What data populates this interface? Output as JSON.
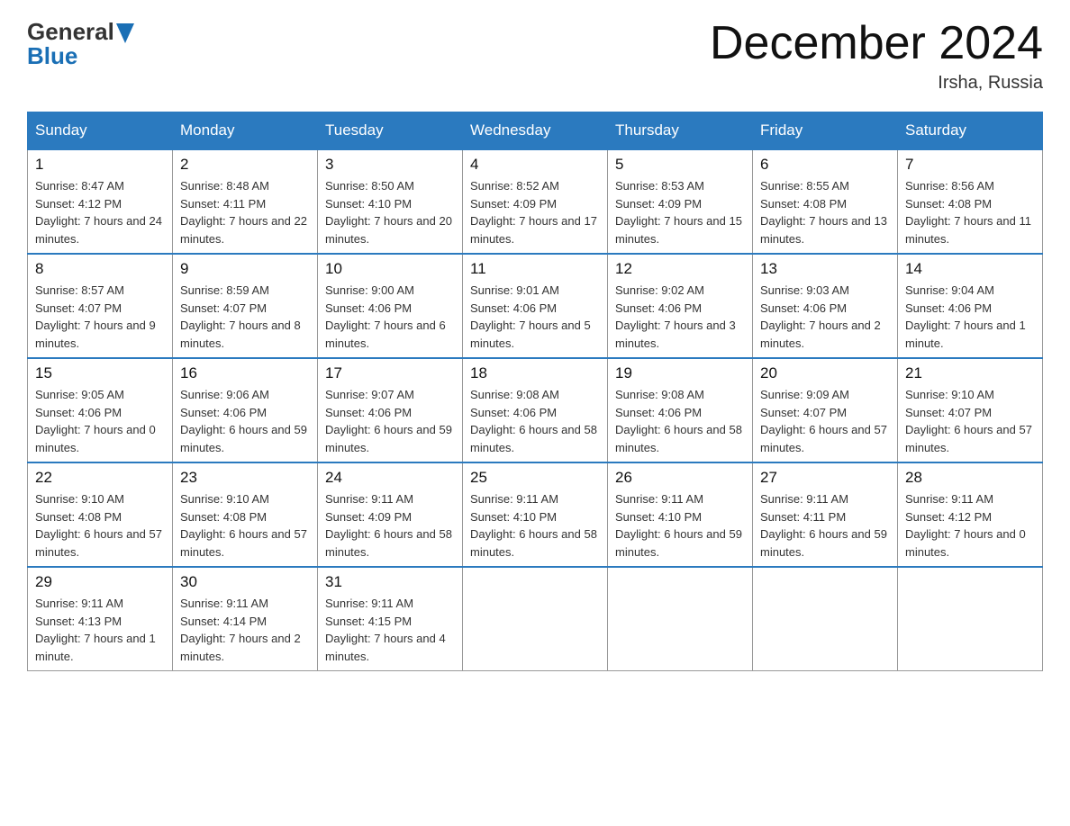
{
  "header": {
    "logo_general": "General",
    "logo_blue": "Blue",
    "month_title": "December 2024",
    "location": "Irsha, Russia"
  },
  "days_of_week": [
    "Sunday",
    "Monday",
    "Tuesday",
    "Wednesday",
    "Thursday",
    "Friday",
    "Saturday"
  ],
  "weeks": [
    [
      {
        "day": "1",
        "sunrise": "8:47 AM",
        "sunset": "4:12 PM",
        "daylight": "7 hours and 24 minutes."
      },
      {
        "day": "2",
        "sunrise": "8:48 AM",
        "sunset": "4:11 PM",
        "daylight": "7 hours and 22 minutes."
      },
      {
        "day": "3",
        "sunrise": "8:50 AM",
        "sunset": "4:10 PM",
        "daylight": "7 hours and 20 minutes."
      },
      {
        "day": "4",
        "sunrise": "8:52 AM",
        "sunset": "4:09 PM",
        "daylight": "7 hours and 17 minutes."
      },
      {
        "day": "5",
        "sunrise": "8:53 AM",
        "sunset": "4:09 PM",
        "daylight": "7 hours and 15 minutes."
      },
      {
        "day": "6",
        "sunrise": "8:55 AM",
        "sunset": "4:08 PM",
        "daylight": "7 hours and 13 minutes."
      },
      {
        "day": "7",
        "sunrise": "8:56 AM",
        "sunset": "4:08 PM",
        "daylight": "7 hours and 11 minutes."
      }
    ],
    [
      {
        "day": "8",
        "sunrise": "8:57 AM",
        "sunset": "4:07 PM",
        "daylight": "7 hours and 9 minutes."
      },
      {
        "day": "9",
        "sunrise": "8:59 AM",
        "sunset": "4:07 PM",
        "daylight": "7 hours and 8 minutes."
      },
      {
        "day": "10",
        "sunrise": "9:00 AM",
        "sunset": "4:06 PM",
        "daylight": "7 hours and 6 minutes."
      },
      {
        "day": "11",
        "sunrise": "9:01 AM",
        "sunset": "4:06 PM",
        "daylight": "7 hours and 5 minutes."
      },
      {
        "day": "12",
        "sunrise": "9:02 AM",
        "sunset": "4:06 PM",
        "daylight": "7 hours and 3 minutes."
      },
      {
        "day": "13",
        "sunrise": "9:03 AM",
        "sunset": "4:06 PM",
        "daylight": "7 hours and 2 minutes."
      },
      {
        "day": "14",
        "sunrise": "9:04 AM",
        "sunset": "4:06 PM",
        "daylight": "7 hours and 1 minute."
      }
    ],
    [
      {
        "day": "15",
        "sunrise": "9:05 AM",
        "sunset": "4:06 PM",
        "daylight": "7 hours and 0 minutes."
      },
      {
        "day": "16",
        "sunrise": "9:06 AM",
        "sunset": "4:06 PM",
        "daylight": "6 hours and 59 minutes."
      },
      {
        "day": "17",
        "sunrise": "9:07 AM",
        "sunset": "4:06 PM",
        "daylight": "6 hours and 59 minutes."
      },
      {
        "day": "18",
        "sunrise": "9:08 AM",
        "sunset": "4:06 PM",
        "daylight": "6 hours and 58 minutes."
      },
      {
        "day": "19",
        "sunrise": "9:08 AM",
        "sunset": "4:06 PM",
        "daylight": "6 hours and 58 minutes."
      },
      {
        "day": "20",
        "sunrise": "9:09 AM",
        "sunset": "4:07 PM",
        "daylight": "6 hours and 57 minutes."
      },
      {
        "day": "21",
        "sunrise": "9:10 AM",
        "sunset": "4:07 PM",
        "daylight": "6 hours and 57 minutes."
      }
    ],
    [
      {
        "day": "22",
        "sunrise": "9:10 AM",
        "sunset": "4:08 PM",
        "daylight": "6 hours and 57 minutes."
      },
      {
        "day": "23",
        "sunrise": "9:10 AM",
        "sunset": "4:08 PM",
        "daylight": "6 hours and 57 minutes."
      },
      {
        "day": "24",
        "sunrise": "9:11 AM",
        "sunset": "4:09 PM",
        "daylight": "6 hours and 58 minutes."
      },
      {
        "day": "25",
        "sunrise": "9:11 AM",
        "sunset": "4:10 PM",
        "daylight": "6 hours and 58 minutes."
      },
      {
        "day": "26",
        "sunrise": "9:11 AM",
        "sunset": "4:10 PM",
        "daylight": "6 hours and 59 minutes."
      },
      {
        "day": "27",
        "sunrise": "9:11 AM",
        "sunset": "4:11 PM",
        "daylight": "6 hours and 59 minutes."
      },
      {
        "day": "28",
        "sunrise": "9:11 AM",
        "sunset": "4:12 PM",
        "daylight": "7 hours and 0 minutes."
      }
    ],
    [
      {
        "day": "29",
        "sunrise": "9:11 AM",
        "sunset": "4:13 PM",
        "daylight": "7 hours and 1 minute."
      },
      {
        "day": "30",
        "sunrise": "9:11 AM",
        "sunset": "4:14 PM",
        "daylight": "7 hours and 2 minutes."
      },
      {
        "day": "31",
        "sunrise": "9:11 AM",
        "sunset": "4:15 PM",
        "daylight": "7 hours and 4 minutes."
      },
      null,
      null,
      null,
      null
    ]
  ]
}
